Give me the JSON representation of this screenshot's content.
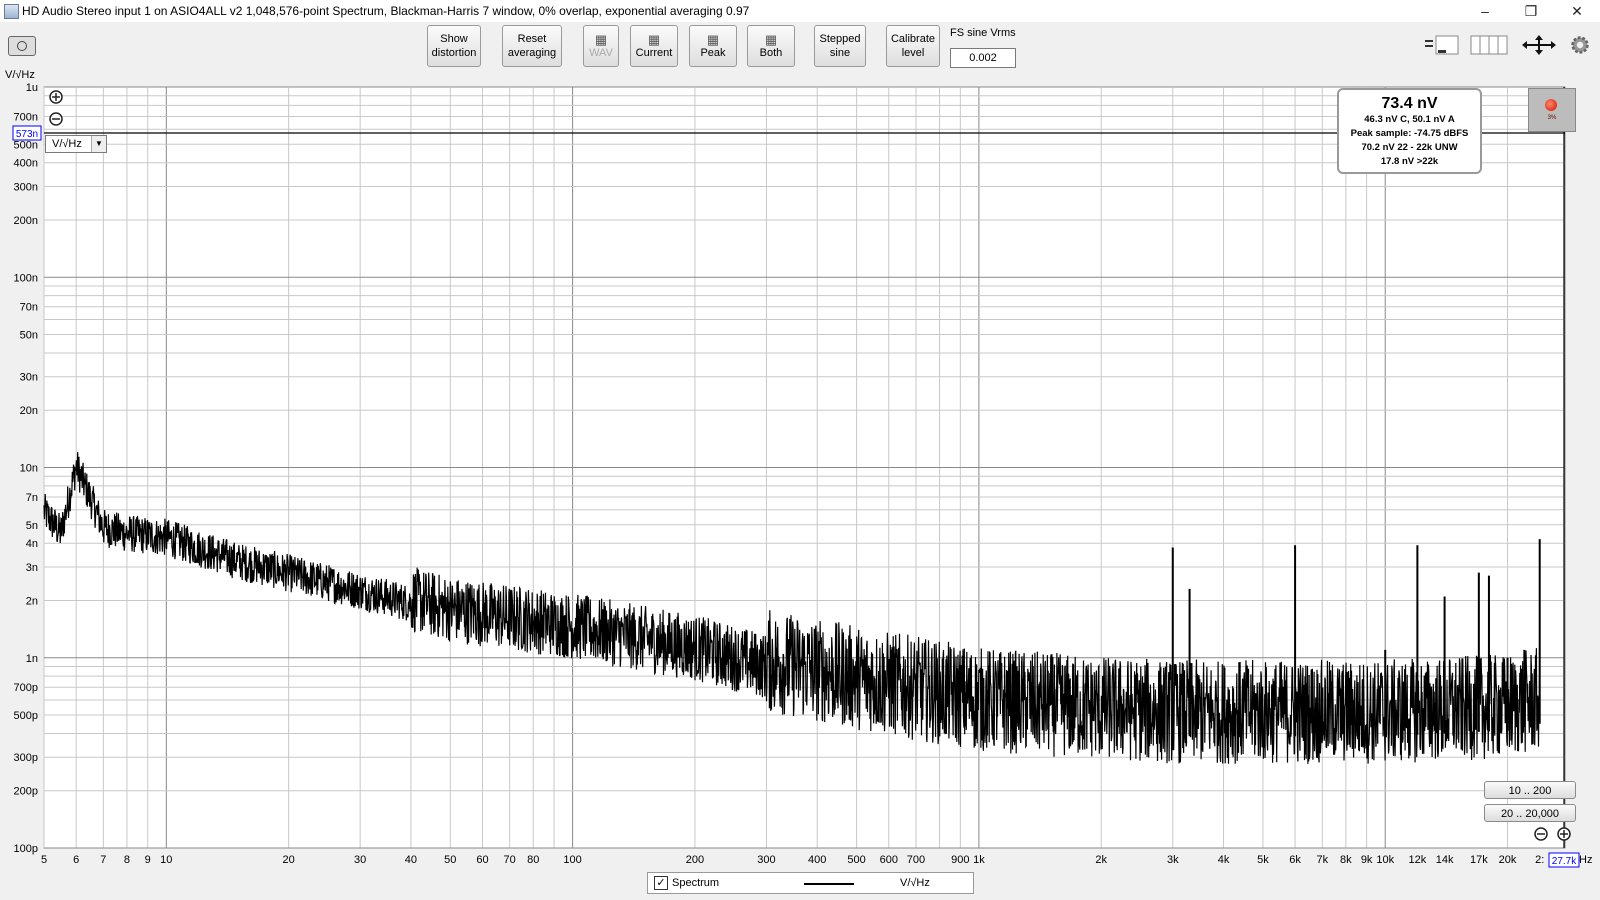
{
  "window": {
    "title": "HD Audio Stereo input 1 on ASIO4ALL v2 1,048,576-point Spectrum, Blackman-Harris 7 window, 0% overlap, exponential averaging 0.97",
    "minimize": "–",
    "restore": "❐",
    "close": "✕"
  },
  "toolbar": {
    "show_distortion": [
      "Show",
      "distortion"
    ],
    "reset_averaging": [
      "Reset",
      "averaging"
    ],
    "wav": "WAV",
    "current": "Current",
    "peak": "Peak",
    "both": "Both",
    "stepped_sine": [
      "Stepped",
      "sine"
    ],
    "calibrate_level": [
      "Calibrate",
      "level"
    ],
    "fs_sine_label": "FS sine Vrms",
    "fs_sine_value": "0.002"
  },
  "readout": {
    "main": "73.4 nV",
    "lines": [
      "46.3 nV C, 50.1 nV A",
      "Peak sample: -74.75 dBFS",
      "70.2 nV 22 - 22k UNW",
      "17.8 nV >22k"
    ],
    "record_percent": "3%"
  },
  "unit_selector": "V/√Hz",
  "range_buttons": [
    "10 .. 200",
    "20 .. 20,000"
  ],
  "legend": {
    "checked": "✓",
    "name": "Spectrum",
    "unit": "V/√Hz"
  },
  "cursor": {
    "y_value": "573n",
    "x_value": "27.7k"
  },
  "colors": {
    "trace": "#000000",
    "background": "#ffffff",
    "grid": "#c8c8c8",
    "cursor_box": "#0000ff"
  },
  "icons": [
    "camera-icon",
    "zoom-in-icon",
    "zoom-out-icon",
    "save-icon",
    "layout-icon",
    "columns-icon",
    "move-arrows-icon",
    "gear-icon",
    "record-icon"
  ],
  "chart_data": {
    "type": "line",
    "x_scale": "log",
    "y_scale": "log",
    "xlim": [
      5,
      27700
    ],
    "ylim": [
      1e-10,
      1e-06
    ],
    "ylabel": "V/√Hz",
    "xunit": "Hz",
    "grid": true,
    "x_ticks": [
      {
        "v": 5,
        "l": "5"
      },
      {
        "v": 6,
        "l": "6"
      },
      {
        "v": 7,
        "l": "7"
      },
      {
        "v": 8,
        "l": "8"
      },
      {
        "v": 9,
        "l": "9"
      },
      {
        "v": 10,
        "l": "10"
      },
      {
        "v": 20,
        "l": "20"
      },
      {
        "v": 30,
        "l": "30"
      },
      {
        "v": 40,
        "l": "40"
      },
      {
        "v": 50,
        "l": "50"
      },
      {
        "v": 60,
        "l": "60"
      },
      {
        "v": 70,
        "l": "70"
      },
      {
        "v": 80,
        "l": "80"
      },
      {
        "v": 100,
        "l": "100"
      },
      {
        "v": 200,
        "l": "200"
      },
      {
        "v": 300,
        "l": "300"
      },
      {
        "v": 400,
        "l": "400"
      },
      {
        "v": 500,
        "l": "500"
      },
      {
        "v": 600,
        "l": "600"
      },
      {
        "v": 700,
        "l": "700"
      },
      {
        "v": 900,
        "l": "900"
      },
      {
        "v": 1000,
        "l": "1k"
      },
      {
        "v": 2000,
        "l": "2k"
      },
      {
        "v": 3000,
        "l": "3k"
      },
      {
        "v": 4000,
        "l": "4k"
      },
      {
        "v": 5000,
        "l": "5k"
      },
      {
        "v": 6000,
        "l": "6k"
      },
      {
        "v": 7000,
        "l": "7k"
      },
      {
        "v": 8000,
        "l": "8k"
      },
      {
        "v": 9000,
        "l": "9k"
      },
      {
        "v": 10000,
        "l": "10k"
      },
      {
        "v": 12000,
        "l": "12k"
      },
      {
        "v": 14000,
        "l": "14k"
      },
      {
        "v": 17000,
        "l": "17k"
      },
      {
        "v": 20000,
        "l": "20k"
      },
      {
        "v": 24000,
        "l": "2:"
      }
    ],
    "x_unit_label": "Hz",
    "y_ticks": [
      {
        "v": 1e-06,
        "l": "1u"
      },
      {
        "v": 7e-07,
        "l": "700n"
      },
      {
        "v": 5e-07,
        "l": "500n"
      },
      {
        "v": 4e-07,
        "l": "400n"
      },
      {
        "v": 3e-07,
        "l": "300n"
      },
      {
        "v": 2e-07,
        "l": "200n"
      },
      {
        "v": 1e-07,
        "l": "100n"
      },
      {
        "v": 7e-08,
        "l": "70n"
      },
      {
        "v": 5e-08,
        "l": "50n"
      },
      {
        "v": 3e-08,
        "l": "30n"
      },
      {
        "v": 2e-08,
        "l": "20n"
      },
      {
        "v": 1e-08,
        "l": "10n"
      },
      {
        "v": 7e-09,
        "l": "7n"
      },
      {
        "v": 5e-09,
        "l": "5n"
      },
      {
        "v": 4e-09,
        "l": "4n"
      },
      {
        "v": 3e-09,
        "l": "3n"
      },
      {
        "v": 2e-09,
        "l": "2n"
      },
      {
        "v": 1e-09,
        "l": "1n"
      },
      {
        "v": 7e-10,
        "l": "700p"
      },
      {
        "v": 5e-10,
        "l": "500p"
      },
      {
        "v": 3e-10,
        "l": "300p"
      },
      {
        "v": 2e-10,
        "l": "200p"
      },
      {
        "v": 1e-10,
        "l": "100p"
      }
    ],
    "series": [
      {
        "values_note": "V/√Hz",
        "x": [
          5,
          5.5,
          6,
          7,
          8,
          10,
          15,
          20,
          30,
          50,
          100,
          200,
          300,
          500,
          1000,
          2000,
          3000,
          5000,
          10000,
          20000,
          24000
        ],
        "y": [
          5.5e-09,
          4.2e-09,
          9.5e-09,
          4.5e-09,
          4.2e-09,
          4e-09,
          3e-09,
          2.6e-09,
          2.1e-09,
          1.6e-09,
          1.3e-09,
          1e-09,
          8e-10,
          6.5e-10,
          5e-10,
          4.5e-10,
          4.3e-10,
          4.3e-10,
          4.3e-10,
          4.6e-10,
          5e-10
        ],
        "spikes": [
          {
            "x": 3000,
            "y": 3.8e-09
          },
          {
            "x": 3300,
            "y": 2.3e-09
          },
          {
            "x": 6000,
            "y": 3.9e-09
          },
          {
            "x": 10000,
            "y": 1.1e-09
          },
          {
            "x": 12000,
            "y": 3.9e-09
          },
          {
            "x": 14000,
            "y": 2.1e-09
          },
          {
            "x": 17000,
            "y": 2.8e-09
          },
          {
            "x": 18000,
            "y": 2.7e-09
          },
          {
            "x": 20000,
            "y": 1e-09
          },
          {
            "x": 22000,
            "y": 1.1e-09
          },
          {
            "x": 24000,
            "y": 4.2e-09
          }
        ]
      }
    ]
  }
}
